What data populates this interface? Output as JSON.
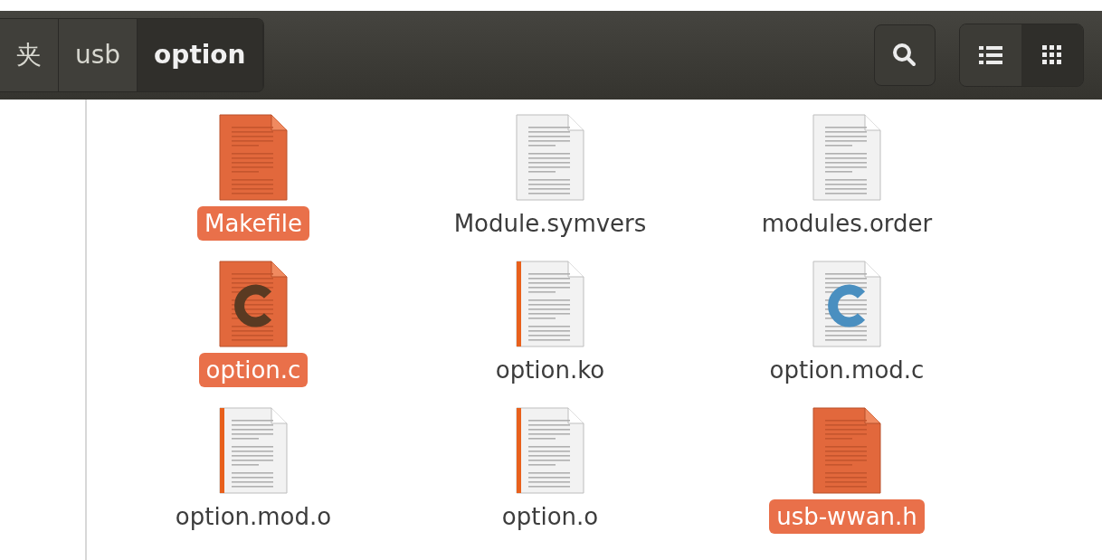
{
  "breadcrumbs": [
    {
      "label": "夹",
      "selected": false
    },
    {
      "label": "usb",
      "selected": false
    },
    {
      "label": "option",
      "selected": true
    }
  ],
  "view_buttons": [
    {
      "kind": "list",
      "selected": false
    },
    {
      "kind": "grid",
      "selected": true
    }
  ],
  "files": [
    {
      "name": "Makefile",
      "kind": "text",
      "selected": true
    },
    {
      "name": "Module.symvers",
      "kind": "text",
      "selected": false
    },
    {
      "name": "modules.order",
      "kind": "text",
      "selected": false
    },
    {
      "name": "option.c",
      "kind": "c",
      "selected": true
    },
    {
      "name": "option.ko",
      "kind": "binary",
      "selected": false
    },
    {
      "name": "option.mod.c",
      "kind": "c",
      "selected": false
    },
    {
      "name": "option.mod.o",
      "kind": "binary",
      "selected": false
    },
    {
      "name": "option.o",
      "kind": "binary",
      "selected": false
    },
    {
      "name": "usb-wwan.h",
      "kind": "text",
      "selected": true
    }
  ]
}
